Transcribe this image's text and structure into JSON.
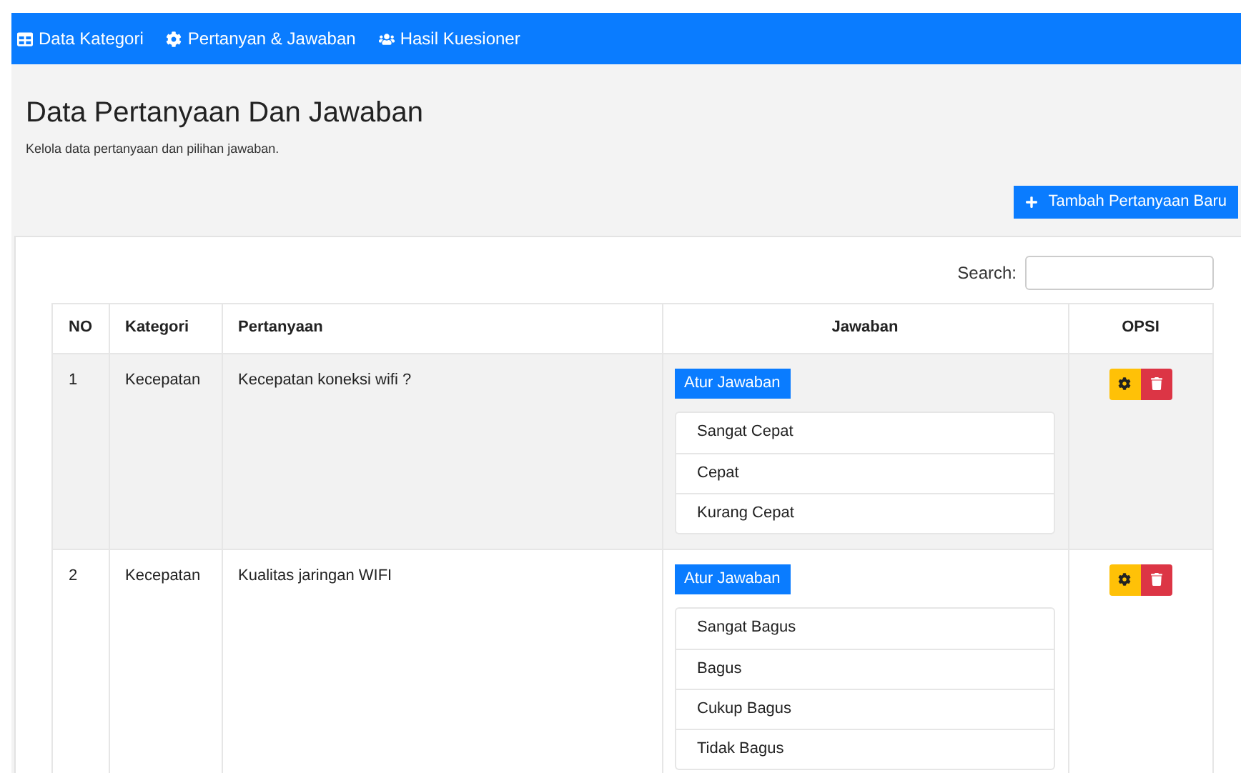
{
  "nav": [
    {
      "label": "Data Kategori"
    },
    {
      "label": "Pertanyan & Jawaban"
    },
    {
      "label": "Hasil Kuesioner"
    }
  ],
  "page": {
    "title": "Data Pertanyaan Dan Jawaban",
    "subtitle": "Kelola data pertanyaan dan pilihan jawaban.",
    "add_button": "Tambah Pertanyaan Baru"
  },
  "search": {
    "label": "Search:"
  },
  "table": {
    "columns": [
      "NO",
      "Kategori",
      "Pertanyaan",
      "Jawaban",
      "OPSI"
    ],
    "rows": [
      {
        "no": "1",
        "kategori": "Kecepatan",
        "pertanyaan": "Kecepatan koneksi wifi ?",
        "button": "Atur Jawaban",
        "answers": [
          "Sangat Cepat",
          "Cepat",
          "Kurang Cepat"
        ],
        "striped": true
      },
      {
        "no": "2",
        "kategori": "Kecepatan",
        "pertanyaan": "Kualitas jaringan WIFI",
        "button": "Atur Jawaban",
        "answers": [
          "Sangat Bagus",
          "Bagus",
          "Cukup Bagus",
          "Tidak Bagus"
        ],
        "striped": false
      }
    ]
  }
}
